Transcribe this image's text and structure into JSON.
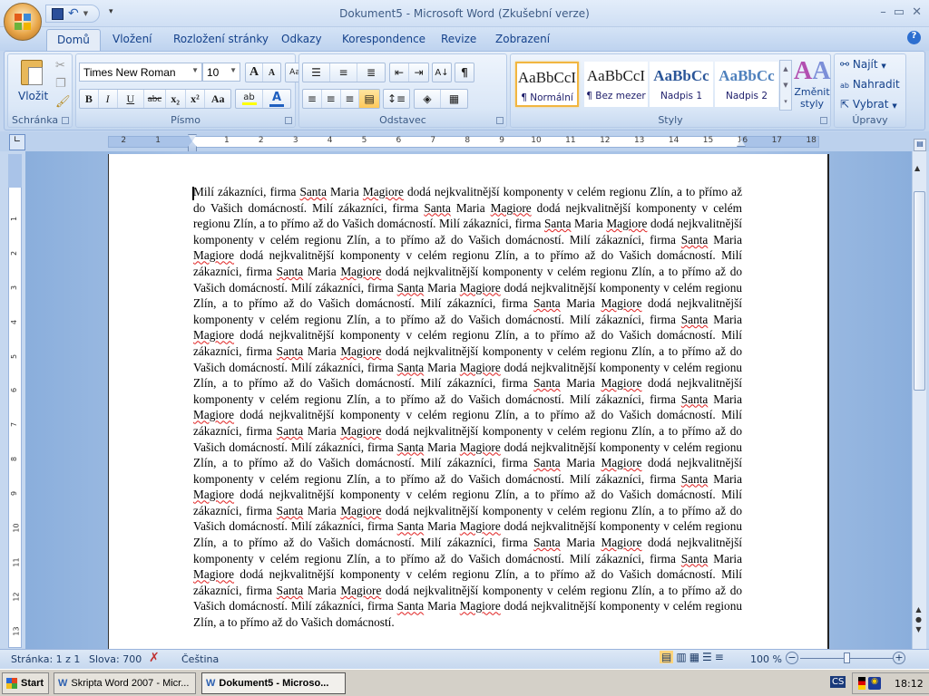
{
  "window": {
    "title": "Dokument5 - Microsoft Word (Zkušební verze)"
  },
  "tabs": [
    {
      "label": "Domů",
      "active": true
    },
    {
      "label": "Vložení"
    },
    {
      "label": "Rozložení stránky"
    },
    {
      "label": "Odkazy"
    },
    {
      "label": "Korespondence"
    },
    {
      "label": "Revize"
    },
    {
      "label": "Zobrazení"
    }
  ],
  "ribbon": {
    "clipboard": {
      "label": "Schránka",
      "paste": "Vložit"
    },
    "font": {
      "label": "Písmo",
      "font_name": "Times New Roman",
      "font_size": "10",
      "bold": "B",
      "italic": "I",
      "underline": "U",
      "strike": "abc",
      "subscript": "x₂",
      "superscript": "x²",
      "case": "Aa",
      "grow": "A",
      "shrink": "A",
      "highlight_color": "#ffff00",
      "font_color": "#1f5fbf"
    },
    "paragraph": {
      "label": "Odstavec",
      "pilcrow": "¶"
    },
    "styles": {
      "label": "Styly",
      "items": [
        {
          "sample": "AaBbCcI",
          "name": "¶ Normální",
          "active": true
        },
        {
          "sample": "AaBbCcI",
          "name": "¶ Bez mezer"
        },
        {
          "sample": "AaBbCc",
          "name": "Nadpis 1"
        },
        {
          "sample": "AaBbCc",
          "name": "Nadpis 2"
        }
      ],
      "change": "Změnit styly"
    },
    "editing": {
      "label": "Úpravy",
      "find": "Najít",
      "replace": "Nahradit",
      "select": "Vybrat"
    }
  },
  "ruler": {
    "ticks": [
      "2",
      "1",
      "",
      "1",
      "2",
      "3",
      "4",
      "5",
      "6",
      "7",
      "8",
      "9",
      "10",
      "11",
      "12",
      "13",
      "14",
      "15",
      "16",
      "17",
      "18"
    ]
  },
  "document": {
    "text": "Milí zákazníci, firma Santa Maria Magiore dodá nejkvalitnější komponenty v celém regionu Zlín, a to přímo až do Vašich domácností. Milí zákazníci, firma Santa Maria Magiore dodá nejkvalitnější komponenty v celém regionu Zlín, a to přímo až do Vašich domácností. Milí zákazníci, firma Santa Maria Magiore dodá nejkvalitnější komponenty v celém regionu Zlín, a to přímo až do Vašich domácností. Milí zákazníci, firma Santa Maria Magiore dodá nejkvalitnější komponenty v celém regionu Zlín, a to přímo až do Vašich domácností. Milí zákazníci, firma Santa Maria Magiore dodá nejkvalitnější komponenty v celém regionu Zlín, a to přímo až do Vašich domácností. Milí zákazníci, firma Santa Maria Magiore dodá nejkvalitnější komponenty v celém regionu Zlín, a to přímo až do Vašich domácností. Milí zákazníci, firma Santa Maria Magiore dodá nejkvalitnější komponenty v celém regionu Zlín, a to přímo až do Vašich domácností. Milí zákazníci, firma Santa Maria Magiore dodá nejkvalitnější komponenty v celém regionu Zlín, a to přímo až do Vašich domácností. Milí zákazníci, firma Santa Maria Magiore dodá nejkvalitnější komponenty v celém regionu Zlín, a to přímo až do Vašich domácností. Milí zákazníci, firma Santa Maria Magiore dodá nejkvalitnější komponenty v celém regionu Zlín, a to přímo až do Vašich domácností. Milí zákazníci, firma Santa Maria Magiore dodá nejkvalitnější komponenty v celém regionu Zlín, a to přímo až do Vašich domácností. Milí zákazníci, firma Santa Maria Magiore dodá nejkvalitnější komponenty v celém regionu Zlín, a to přímo až do Vašich domácností. Milí zákazníci, firma Santa Maria Magiore dodá nejkvalitnější komponenty v celém regionu Zlín, a to přímo až do Vašich domácností. Milí zákazníci, firma Santa Maria Magiore dodá nejkvalitnější komponenty v celém regionu Zlín, a to přímo až do Vašich domácností. Milí zákazníci, firma Santa Maria Magiore dodá nejkvalitnější komponenty v celém regionu Zlín, a to přímo až do Vašich domácností. Milí zákazníci, firma Santa Maria Magiore dodá nejkvalitnější komponenty v celém regionu Zlín, a to přímo až do Vašich domácností. Milí zákazníci, firma Santa Maria Magiore dodá nejkvalitnější komponenty v celém regionu Zlín, a to přímo až do Vašich domácností. Milí zákazníci, firma Santa Maria Magiore dodá nejkvalitnější komponenty v celém regionu Zlín, a to přímo až do Vašich domácností. Milí zákazníci, firma Santa Maria Magiore dodá nejkvalitnější komponenty v celém regionu Zlín, a to přímo až do Vašich domácností. Milí zákazníci, firma Santa Maria Magiore dodá nejkvalitnější komponenty v celém regionu Zlín, a to přímo až do Vašich domácností. Milí zákazníci, firma Santa Maria Magiore dodá nejkvalitnější komponenty v celém regionu Zlín, a to přímo až do Vašich domácností. Milí zákazníci, firma Santa Maria Magiore dodá nejkvalitnější komponenty v celém regionu Zlín, a to přímo až do Vašich domácností.",
    "spelling_flagged": [
      "Santa",
      "Magiore"
    ]
  },
  "status": {
    "page": "Stránka: 1 z 1",
    "words": "Slova: 700",
    "language": "Čeština",
    "zoom": "100 %",
    "zoom_percent": 100
  },
  "taskbar": {
    "start": "Start",
    "tasks": [
      {
        "label": "Skripta Word 2007 - Micr..."
      },
      {
        "label": "Dokument5 - Microso...",
        "active": true
      }
    ],
    "lang": "CS",
    "clock": "18:12"
  }
}
